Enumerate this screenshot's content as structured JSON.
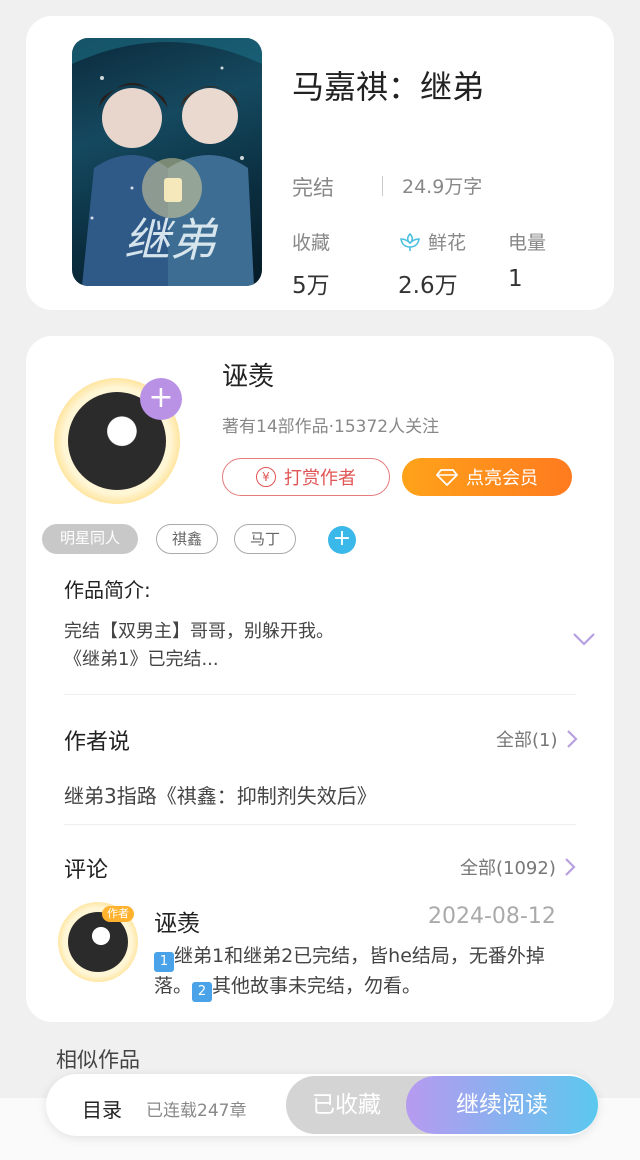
{
  "book": {
    "title": "马嘉祺：继弟",
    "status": "完结",
    "word_count": "24.9万字",
    "cover_text": "继弟",
    "stats": [
      {
        "label": "收藏",
        "value": "5万",
        "icon": null
      },
      {
        "label": "鲜花",
        "value": "2.6万",
        "icon": "flower-icon"
      },
      {
        "label": "电量",
        "value": "1",
        "icon": null
      }
    ]
  },
  "author": {
    "name": "诬羡",
    "meta": "著有14部作品·15372人关注",
    "tip_button": "打赏作者",
    "tip_icon_glyph": "¥",
    "vip_button": "点亮会员",
    "follow_glyph": "+",
    "tags": [
      "明星同人",
      "祺鑫",
      "马丁"
    ],
    "add_tag_glyph": "+"
  },
  "intro": {
    "title": "作品简介:",
    "line1": "完结【双男主】哥哥，别躲开我。",
    "line2": "《继弟1》已完结..."
  },
  "author_say": {
    "title": "作者说",
    "more": "全部(1)",
    "text": "继弟3指路《祺鑫：抑制剂失效后》"
  },
  "comments": {
    "title": "评论",
    "more": "全部(1092)",
    "item": {
      "user": "诬羡",
      "badge": "作者",
      "date": "2024-08-12",
      "part1_num": "1",
      "part1": "继弟1和继弟2已完结，皆he结局，无番外掉落。",
      "part2_num": "2",
      "part2": "其他故事未完结，勿看。"
    }
  },
  "similar_title": "相似作品",
  "bottom": {
    "toc": "目录",
    "chapters": "已连载247章",
    "collected": "已收藏",
    "continue": "继续阅读"
  },
  "colors": {
    "accent_orange": "#ff8c1a",
    "accent_purple": "#b992e6",
    "accent_blue": "#5bc8ee",
    "tip_red": "#e05555"
  }
}
